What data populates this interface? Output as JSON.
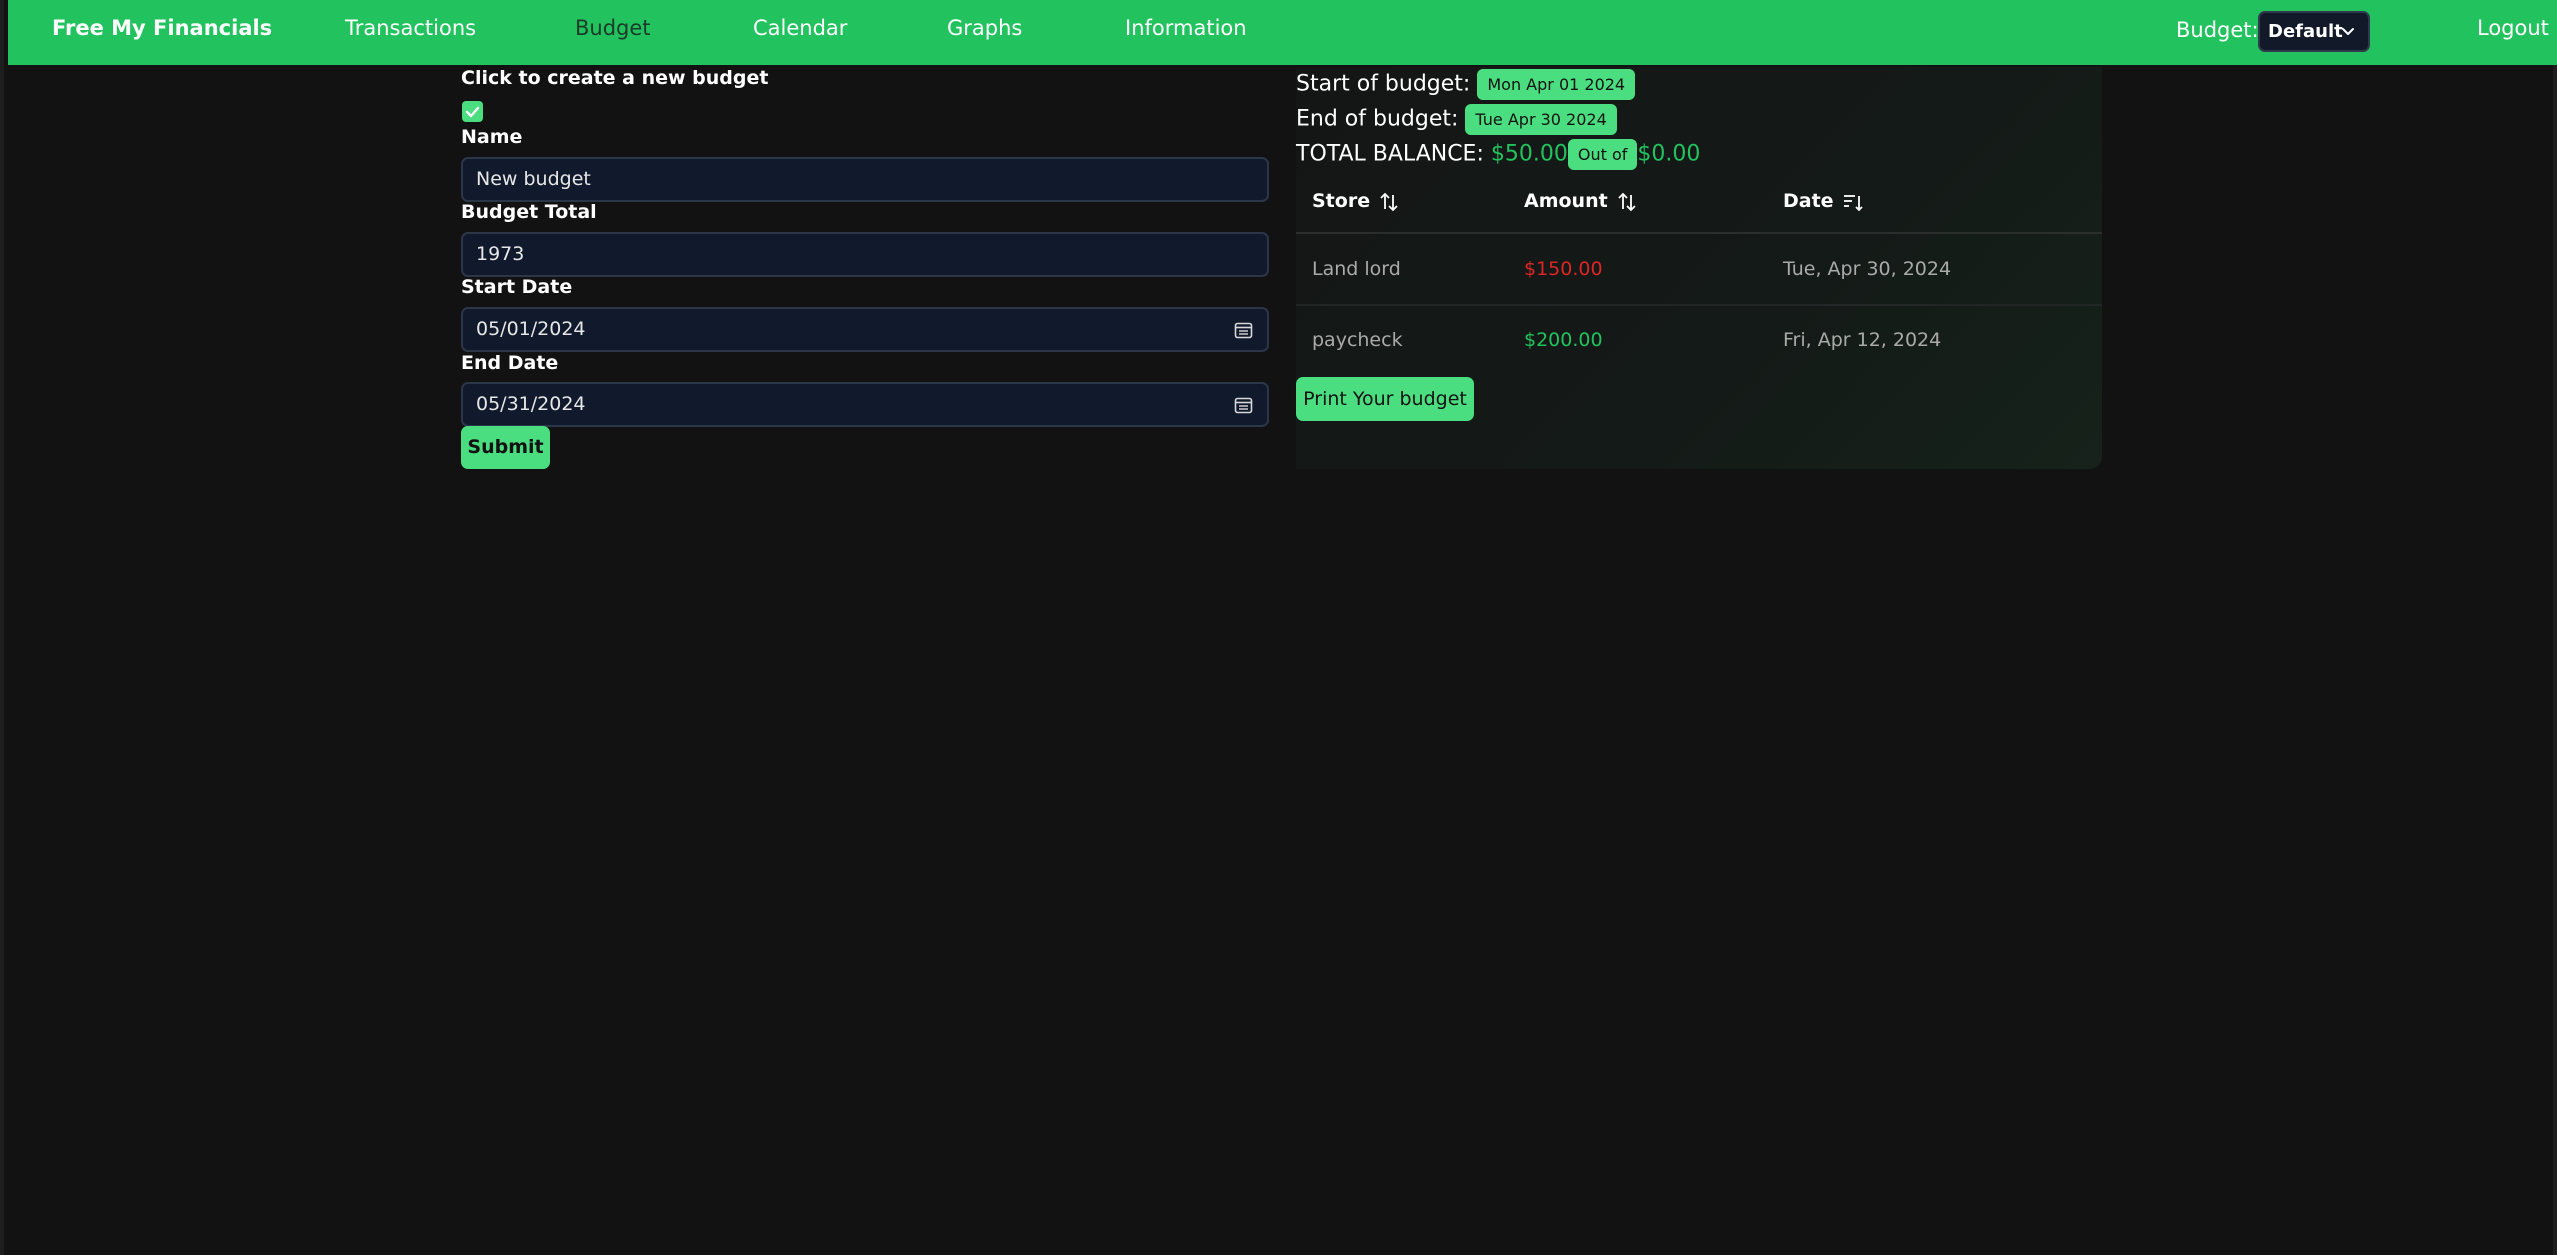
{
  "nav": {
    "brand": "Free My Financials",
    "items": [
      {
        "label": "Transactions"
      },
      {
        "label": "Budget"
      },
      {
        "label": "Calendar"
      },
      {
        "label": "Graphs"
      },
      {
        "label": "Information"
      }
    ],
    "budget_label": "Budget:",
    "budget_selected": "Default",
    "logout": "Logout",
    "accent_color": "#22c35e"
  },
  "form": {
    "create_prompt": "Click to create a new budget",
    "create_checked": true,
    "name_label": "Name",
    "name_value": "New budget",
    "total_label": "Budget Total",
    "total_value": "1973",
    "start_label": "Start Date",
    "start_value": "05/01/2024",
    "end_label": "End Date",
    "end_value": "05/31/2024",
    "submit": "Submit"
  },
  "summary": {
    "start_label": "Start of budget:",
    "start_value": "Mon Apr 01 2024",
    "end_label": "End of budget:",
    "end_value": "Tue Apr 30 2024",
    "balance_label": "TOTAL BALANCE:",
    "balance_value": "$50.00",
    "out_of_label": "Out of",
    "out_of_value": "$0.00"
  },
  "table": {
    "columns": [
      {
        "label": "Store",
        "sort_icon": "sort-both-icon"
      },
      {
        "label": "Amount",
        "sort_icon": "sort-both-icon"
      },
      {
        "label": "Date",
        "sort_icon": "sort-desc-icon"
      }
    ],
    "rows": [
      {
        "store": "Land lord",
        "amount": "$150.00",
        "date": "Tue, Apr 30, 2024",
        "type": "expense"
      },
      {
        "store": "paycheck",
        "amount": "$200.00",
        "date": "Fri, Apr 12, 2024",
        "type": "income"
      }
    ]
  },
  "print_button": "Print Your budget"
}
